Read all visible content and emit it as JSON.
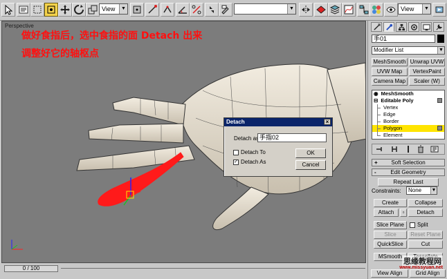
{
  "toolbar": {
    "view_dropdown_1": "View",
    "view_dropdown_2": "View",
    "selection_set": ""
  },
  "viewport": {
    "label": "Perspective",
    "annotation_line1": "做好食指后，选中食指的面 Detach 出来",
    "annotation_line2": "调整好它的轴枢点",
    "colors": {
      "background": "#7c7c7c",
      "mesh": "#e0d8c8",
      "selected": "#ff1a1a"
    }
  },
  "detach_dialog": {
    "title": "Detach",
    "detach_as_label": "Detach as:",
    "detach_as_value": "手指02",
    "detach_to_label": "Detach To",
    "detach_to_checked": false,
    "detach_as_clone_label": "Detach As",
    "detach_as_clone_checked": true,
    "ok_label": "OK",
    "cancel_label": "Cancel"
  },
  "timeline": {
    "frame_label": "0 / 100"
  },
  "command_panel": {
    "object_name": "手01",
    "modifier_list": "Modifier List",
    "modifier_buttons": [
      "MeshSmooth",
      "Unwrap UVW",
      "UVW Map",
      "VertexPaint",
      "Camera Map",
      "Scaler (W)"
    ],
    "stack": {
      "items": [
        {
          "label": "MeshSmooth",
          "bold": true,
          "selected": false
        },
        {
          "label": "Editable Poly",
          "bold": true,
          "selected": false
        },
        {
          "label": "Vertex",
          "bold": false,
          "selected": false
        },
        {
          "label": "Edge",
          "bold": false,
          "selected": false
        },
        {
          "label": "Border",
          "bold": false,
          "selected": false
        },
        {
          "label": "Polygon",
          "bold": false,
          "selected": true
        },
        {
          "label": "Element",
          "bold": false,
          "selected": false
        }
      ]
    },
    "soft_selection_label": "Soft Selection",
    "edit_geometry_label": "Edit Geometry",
    "repeat_last_label": "Repeat Last",
    "constraints_label": "Constraints:",
    "constraints_value": "None",
    "create_label": "Create",
    "collapse_label": "Collapse",
    "attach_label": "Attach",
    "detach_label": "Detach",
    "slice_plane_label": "Slice Plane",
    "split_label": "Split",
    "slice_label": "Slice",
    "reset_plane_label": "Reset Plane",
    "quickslice_label": "QuickSlice",
    "cut_label": "Cut",
    "msmooth_label": "MSmooth",
    "tessellate_label": "Tessellate",
    "view_align_label": "View Align",
    "grid_align_label": "Grid Align"
  },
  "watermark": {
    "text": "思缘教程网",
    "url": "www.missyuan.net"
  }
}
